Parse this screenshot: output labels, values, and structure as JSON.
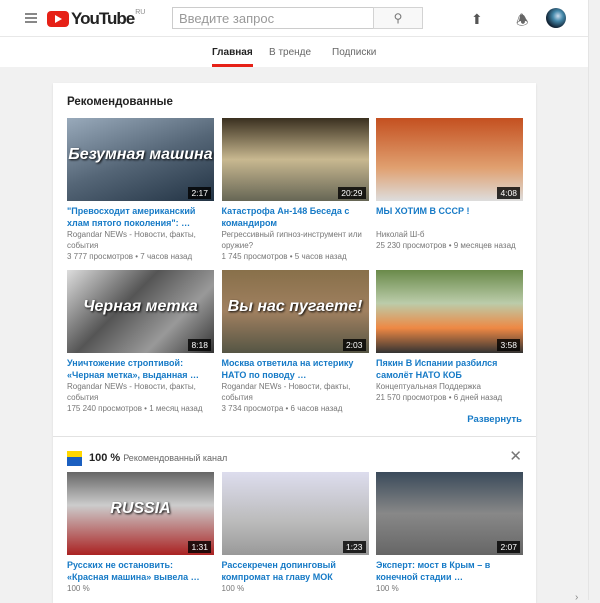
{
  "header": {
    "logo": "YouTube",
    "region": "RU",
    "search_placeholder": "Введите запрос",
    "icons": [
      "menu-icon",
      "search-icon",
      "upload-icon",
      "bell-icon",
      "avatar"
    ]
  },
  "tabs": [
    {
      "label": "Главная",
      "active": true
    },
    {
      "label": "В тренде"
    },
    {
      "label": "Подписки"
    }
  ],
  "recommended": {
    "title": "Рекомендованные",
    "expand_label": "Развернуть",
    "videos": [
      {
        "title": "\"Превосходит американский хлам пятого поколения\":   …",
        "channel": "Rogandar NEWs - Новости, факты, события",
        "stats": "3 777 просмотров • 7 часов назад",
        "duration": "2:17",
        "thumb_text": "Безумная машина"
      },
      {
        "title": "Катастрофа Ан-148 Беседа с командиром",
        "channel": "Регрессивный гипноз-инструмент или оружие?",
        "stats": "1 745 просмотров • 5 часов назад",
        "duration": "20:29"
      },
      {
        "title": "МЫ ХОТИМ В СССР !",
        "channel": "Николай Ш-б",
        "stats": "25 230 просмотров • 9 месяцев назад",
        "duration": "4:08"
      },
      {
        "title": "Уничтожение строптивой: «Черная метка», выданная …",
        "channel": "Rogandar NEWs - Новости, факты, события",
        "stats": "175 240 просмотров • 1 месяц назад",
        "duration": "8:18",
        "thumb_text": "Черная метка"
      },
      {
        "title": "Москва ответила на истерику НАТО по поводу   …",
        "channel": "Rogandar NEWs - Новости, факты, события",
        "stats": "3 734 просмотра • 6 часов назад",
        "duration": "2:03",
        "thumb_text": "Вы нас пугаете!"
      },
      {
        "title": "Пякин В Испании разбился самолёт НАТО КОБ",
        "channel": "Концептуальная Поддержка",
        "stats": "21 570 просмотров • 6 дней назад",
        "duration": "3:58"
      }
    ]
  },
  "channel_shelf": {
    "name": "100 %",
    "label": "Рекомендованный канал",
    "videos": [
      {
        "title": "Русских не остановить: «Красная машина» вывела …",
        "channel": "100 %",
        "duration": "1:31",
        "thumb_text": "RUSSIA"
      },
      {
        "title": "Рассекречен допинговый компромат на главу МОК",
        "channel": "100 %",
        "duration": "1:23"
      },
      {
        "title": "Эксперт: мост в Крым – в конечной стадии   …",
        "channel": "100 %",
        "duration": "2:07"
      }
    ]
  },
  "colors": {
    "brand": "#e62117",
    "link": "#167ac6"
  }
}
